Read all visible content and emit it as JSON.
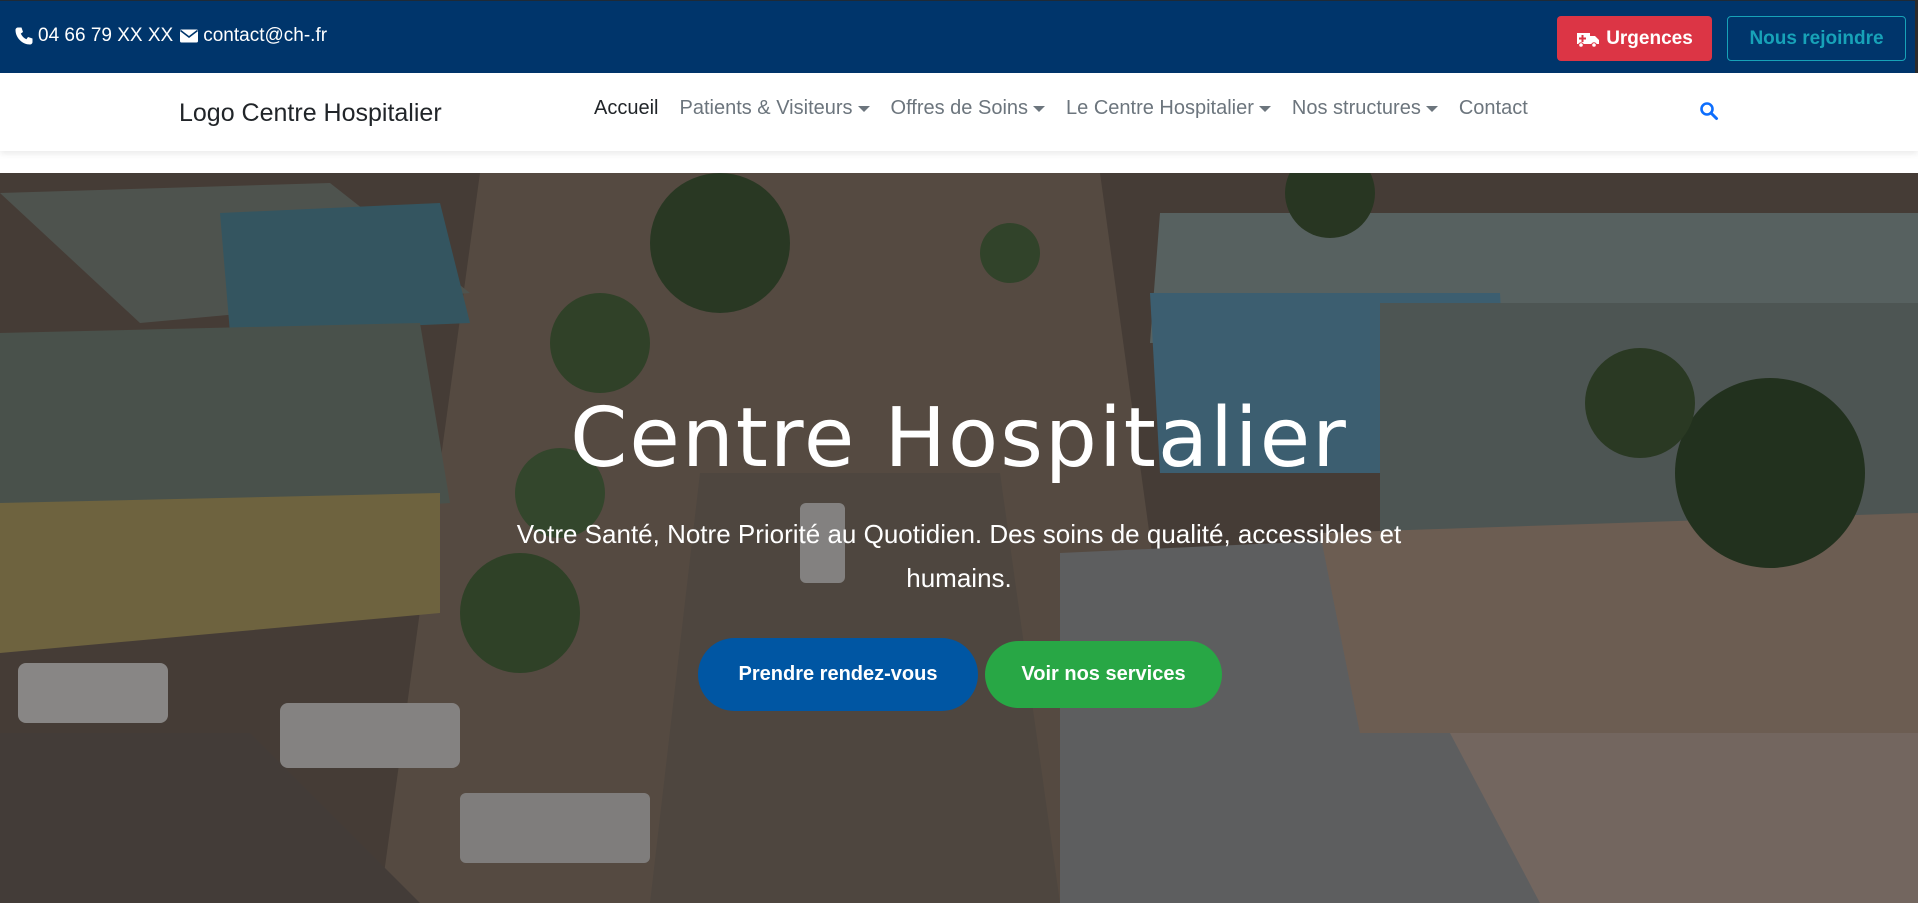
{
  "topbar": {
    "phone_icon": "phone-icon",
    "phone": "04 66 79 XX XX",
    "email_icon": "envelope-icon",
    "email": "contact@ch-.fr",
    "urgences_icon": "ambulance-icon",
    "urgences_label": "Urgences",
    "join_label": "Nous rejoindre",
    "colors": {
      "background": "#00356b",
      "urgences": "#dc3545",
      "join": "#17a2b8"
    }
  },
  "navbar": {
    "logo": "Logo Centre Hospitalier",
    "items": [
      {
        "label": "Accueil",
        "dropdown": false,
        "active": true
      },
      {
        "label": "Patients & Visiteurs",
        "dropdown": true,
        "active": false
      },
      {
        "label": "Offres de Soins",
        "dropdown": true,
        "active": false
      },
      {
        "label": "Le Centre Hospitalier",
        "dropdown": true,
        "active": false
      },
      {
        "label": "Nos structures",
        "dropdown": true,
        "active": false
      },
      {
        "label": "Contact",
        "dropdown": false,
        "active": false
      }
    ],
    "search_icon": "search-icon",
    "search_color": "#0d6efd"
  },
  "hero": {
    "title": "Centre Hospitalier",
    "subtitle": "Votre Santé, Notre Priorité au Quotidien. Des soins de qualité, accessibles et humains.",
    "primary_button": "Prendre rendez-vous",
    "secondary_button": "Voir nos services",
    "colors": {
      "primary": "#0056a3",
      "secondary": "#28a745"
    },
    "background_image": "aerial-hospital-campus-image"
  }
}
